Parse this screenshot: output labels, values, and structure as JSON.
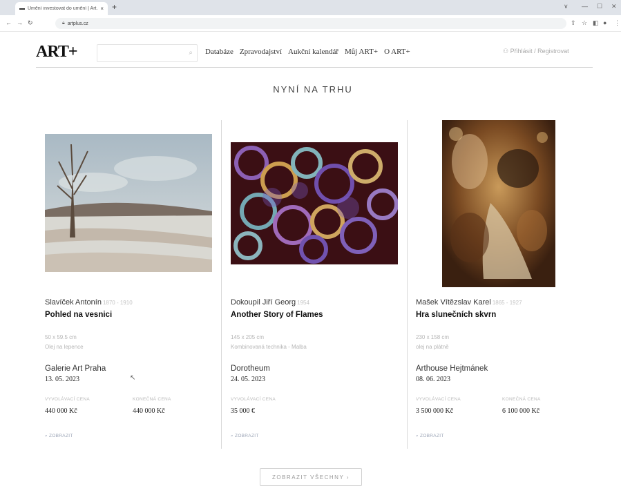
{
  "browser": {
    "tab_title": "Umění investovat do umění | Art...",
    "tab_close": "×",
    "new_tab": "+",
    "window_controls": [
      "∨",
      "—",
      "☐",
      "✕"
    ],
    "url": "artplus.cz"
  },
  "header": {
    "logo": "ART+",
    "search_placeholder": "",
    "nav": [
      "Databáze",
      "Zpravodajství",
      "Aukční kalendář",
      "Můj ART+",
      "O ART+"
    ],
    "login": "Přihlásit / Registrovat"
  },
  "section_title": "NYNÍ NA TRHU",
  "price_labels": {
    "start": "VYVOLÁVACÍ CENA",
    "end": "KONEČNÁ CENA"
  },
  "view_label": "ZOBRAZIT",
  "cards": [
    {
      "artist": "Slavíček Antonín",
      "years": "1870 - 1910",
      "title": "Pohled na vesnici",
      "dimensions": "50 x 59.5 cm",
      "medium": "Olej na lepence",
      "auction_house": "Galerie Art Praha",
      "date": "13. 05. 2023",
      "start_price": "440 000 Kč",
      "end_price": "440 000 Kč"
    },
    {
      "artist": "Dokoupil Jiří Georg",
      "years": "1954",
      "title": "Another Story of Flames",
      "dimensions": "145 x 205 cm",
      "medium": "Kombinovaná technika - Malba",
      "auction_house": "Dorotheum",
      "date": "24. 05. 2023",
      "start_price": "35 000 €",
      "end_price": ""
    },
    {
      "artist": "Mašek Vítězslav Karel",
      "years": "1865 - 1927",
      "title": "Hra slunečních skvrn",
      "dimensions": "230 x 158 cm",
      "medium": "olej na plátně",
      "auction_house": "Arthouse Hejtmánek",
      "date": "08. 06. 2023",
      "start_price": "3 500 000 Kč",
      "end_price": "6 100 000 Kč"
    }
  ],
  "show_all": "ZOBRAZIT VŠECHNY ›"
}
